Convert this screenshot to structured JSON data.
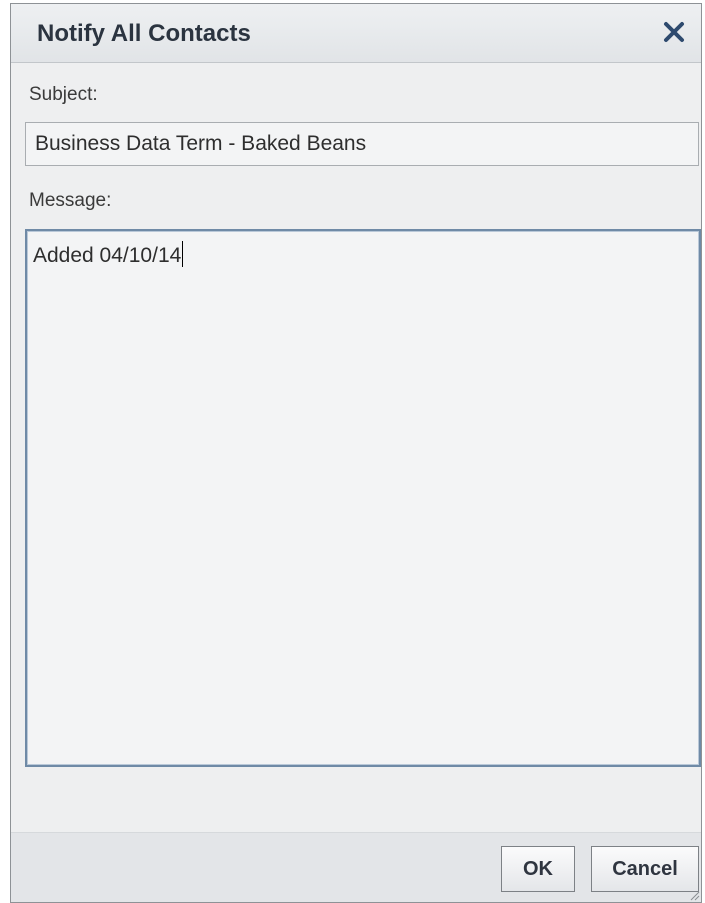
{
  "dialog": {
    "title": "Notify All Contacts",
    "close_icon": "close-icon"
  },
  "form": {
    "subject_label": "Subject:",
    "subject_value": "Business Data Term - Baked Beans",
    "message_label": "Message:",
    "message_value": "Added 04/10/14"
  },
  "buttons": {
    "ok_label": "OK",
    "cancel_label": "Cancel"
  },
  "colors": {
    "title_text": "#2b3440",
    "focus_border": "#6f8aa6",
    "dialog_bg": "#eeeff0"
  }
}
